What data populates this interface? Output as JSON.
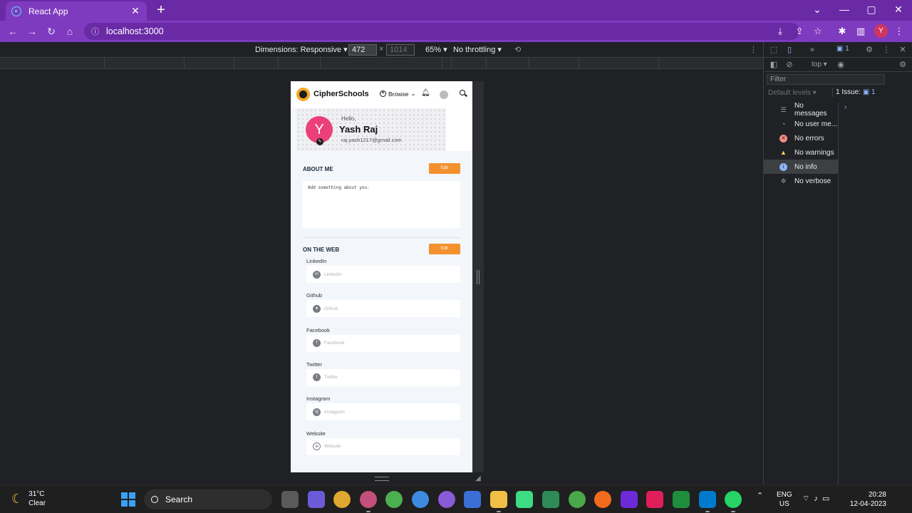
{
  "browser": {
    "tab_title": "React App",
    "url": "localhost:3000"
  },
  "device_toolbar": {
    "dimensions_label": "Dimensions: Responsive",
    "width": "472",
    "height": "1014",
    "zoom": "65%",
    "throttling": "No throttling"
  },
  "page": {
    "brand": "CipherSchools",
    "browse": "Browse",
    "greeting": "Hello,",
    "name": "Yash Raj",
    "email": "raj.yash1217@gmail.com",
    "avatar_initial": "Y",
    "about": {
      "title": "ABOUT ME",
      "edit": "Edit",
      "placeholder": "Add something about you."
    },
    "web": {
      "title": "ON THE WEB",
      "edit": "Edit",
      "links": [
        {
          "label": "LinkedIn",
          "placeholder": "LinkedIn",
          "icon": "in"
        },
        {
          "label": "Github",
          "placeholder": "Github",
          "icon": "gh"
        },
        {
          "label": "Facebook",
          "placeholder": "Facebook",
          "icon": "f"
        },
        {
          "label": "Twitter",
          "placeholder": "Twitter",
          "icon": "t"
        },
        {
          "label": "Instagram",
          "placeholder": "Instagram",
          "icon": "ig"
        },
        {
          "label": "Website",
          "placeholder": "Website",
          "icon": "www"
        }
      ]
    }
  },
  "devtools": {
    "issues_badge": "1",
    "context": "top",
    "filter_placeholder": "Filter",
    "levels": "Default levels",
    "issues_label": "1 Issue:",
    "issues_count": "1",
    "sidebar": [
      {
        "label": "No messages",
        "icon": "list"
      },
      {
        "label": "No user me...",
        "icon": "user"
      },
      {
        "label": "No errors",
        "icon": "error"
      },
      {
        "label": "No warnings",
        "icon": "warning"
      },
      {
        "label": "No info",
        "icon": "info"
      },
      {
        "label": "No verbose",
        "icon": "bug"
      }
    ]
  },
  "taskbar": {
    "temperature": "31°C",
    "weather": "Clear",
    "search": "Search",
    "lang_line1": "ENG",
    "lang_line2": "US",
    "time": "20:28",
    "date": "12-04-2023",
    "profile_initial": "Y"
  }
}
